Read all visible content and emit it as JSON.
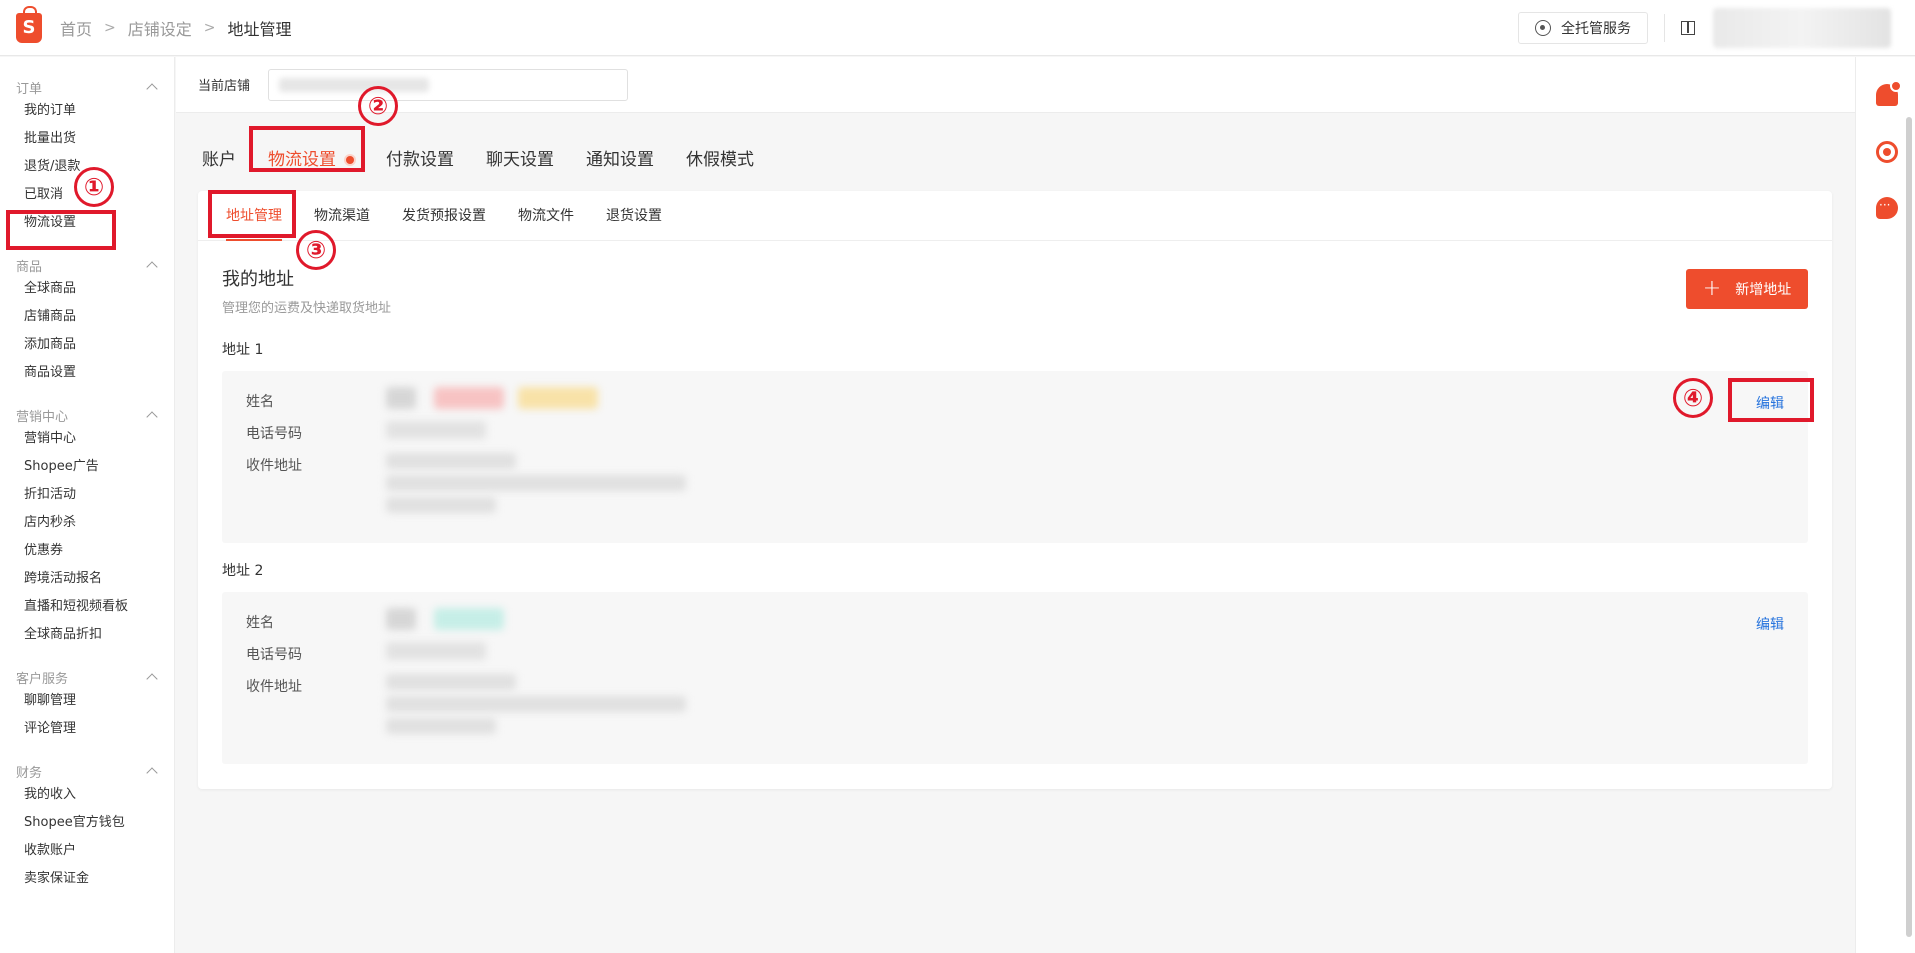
{
  "header": {
    "breadcrumb": [
      "首页",
      "店铺设定",
      "地址管理"
    ],
    "service_button": "全托管服务"
  },
  "sidebar": {
    "groups": [
      {
        "title": "订单",
        "items": [
          "我的订单",
          "批量出货",
          "退货/退款",
          "已取消",
          "物流设置"
        ]
      },
      {
        "title": "商品",
        "items": [
          "全球商品",
          "店铺商品",
          "添加商品",
          "商品设置"
        ]
      },
      {
        "title": "营销中心",
        "items": [
          "营销中心",
          "Shopee广告",
          "折扣活动",
          "店内秒杀",
          "优惠券",
          "跨境活动报名",
          "直播和短视频看板",
          "全球商品折扣"
        ]
      },
      {
        "title": "客户服务",
        "items": [
          "聊聊管理",
          "评论管理"
        ]
      },
      {
        "title": "财务",
        "items": [
          "我的收入",
          "Shopee官方钱包",
          "收款账户",
          "卖家保证金"
        ]
      }
    ]
  },
  "store": {
    "label": "当前店铺"
  },
  "tabs": [
    "账户",
    "物流设置",
    "付款设置",
    "聊天设置",
    "通知设置",
    "休假模式"
  ],
  "subtabs": [
    "地址管理",
    "物流渠道",
    "发货预报设置",
    "物流文件",
    "退货设置"
  ],
  "section": {
    "title": "我的地址",
    "desc": "管理您的运费及快递取货地址",
    "add_button": "新增地址"
  },
  "addresses": [
    {
      "heading": "地址 1",
      "labels": [
        "姓名",
        "电话号码",
        "收件地址"
      ],
      "edit": "编辑"
    },
    {
      "heading": "地址 2",
      "labels": [
        "姓名",
        "电话号码",
        "收件地址"
      ],
      "edit": "编辑"
    }
  ],
  "annotations": [
    "①",
    "②",
    "③",
    "④"
  ],
  "colors": {
    "accent": "#ee4d2d",
    "link": "#2673dd",
    "annotation": "#e0192b"
  }
}
